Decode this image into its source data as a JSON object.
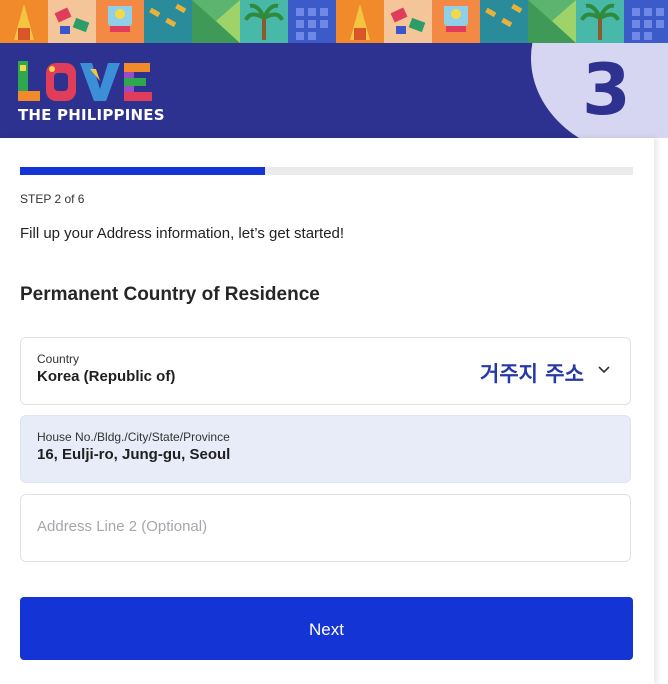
{
  "header": {
    "logo_text": "LOVE",
    "logo_subtitle": "THE PHILIPPINES",
    "step_badge": "3"
  },
  "progress": {
    "fraction": 0.4,
    "step_label": "STEP 2 of 6"
  },
  "intro_text": "Fill up your Address information, let’s get started!",
  "section_title": "Permanent Country of Residence",
  "fields": {
    "country": {
      "label": "Country",
      "value": "Korea (Republic of)",
      "annotation": "거주지 주소",
      "icon": "chevron-down-icon"
    },
    "address1": {
      "label": "House No./Bldg./City/State/Province",
      "value": "16, Eulji-ro, Jung-gu, Seoul"
    },
    "address2": {
      "placeholder": "Address Line 2 (Optional)"
    }
  },
  "next_button": "Next",
  "colors": {
    "header_bg": "#2d318f",
    "accent": "#1534d6",
    "badge_bg": "#d6d6f2",
    "filled_field_bg": "#e8ecf8",
    "annotation": "#2639a8"
  }
}
